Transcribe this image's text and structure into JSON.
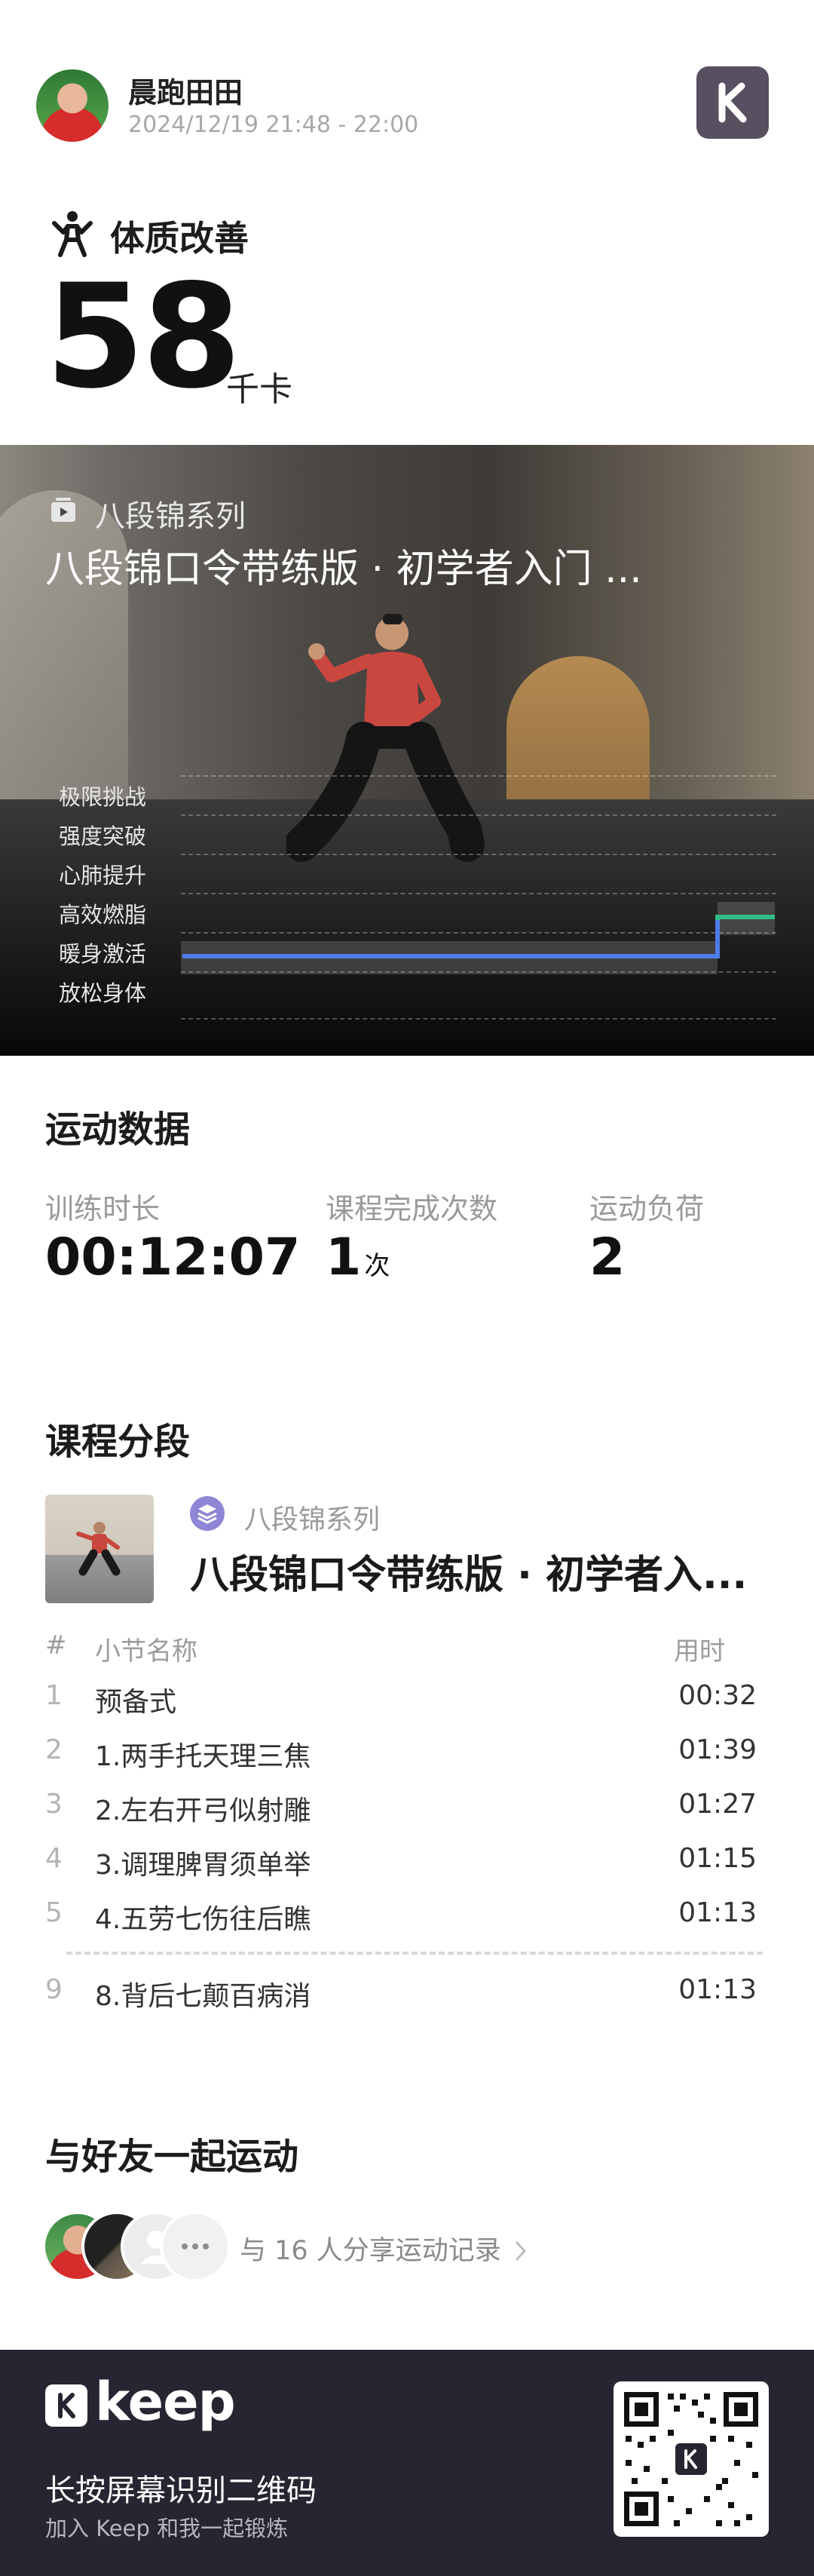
{
  "user": {
    "name": "晨跑田田",
    "time_range": "2024/12/19 21:48 - 22:00"
  },
  "goal": {
    "label": "体质改善",
    "calories": "58",
    "calories_unit": "千卡"
  },
  "hero": {
    "series": "八段锦系列",
    "course_title": "八段锦口令带练版 · 初学者入门 ...",
    "intensity_zones": [
      "极限挑战",
      "强度突破",
      "心肺提升",
      "高效燃脂",
      "暖身激活",
      "放松身体"
    ],
    "intensity_colors": {
      "warmup": "#4f7be6",
      "fatburn": "#2fbf84"
    }
  },
  "stats": {
    "title": "运动数据",
    "items": [
      {
        "label": "训练时长",
        "value": "00:12:07",
        "unit": ""
      },
      {
        "label": "课程完成次数",
        "value": "1",
        "unit": "次"
      },
      {
        "label": "运动负荷",
        "value": "2",
        "unit": ""
      }
    ]
  },
  "segments": {
    "title": "课程分段",
    "series": "八段锦系列",
    "course_title": "八段锦口令带练版 · 初学者入...",
    "headers": {
      "index": "#",
      "name": "小节名称",
      "time": "用时"
    },
    "rows": [
      {
        "index": "1",
        "name": "预备式",
        "time": "00:32"
      },
      {
        "index": "2",
        "name": "1.两手托天理三焦",
        "time": "01:39"
      },
      {
        "index": "3",
        "name": "2.左右开弓似射雕",
        "time": "01:27"
      },
      {
        "index": "4",
        "name": "3.调理脾胃须单举",
        "time": "01:15"
      },
      {
        "index": "5",
        "name": "4.五劳七伤往后瞧",
        "time": "01:13"
      }
    ],
    "last_row": {
      "index": "9",
      "name": "8.背后七颠百病消",
      "time": "01:13"
    }
  },
  "friends": {
    "title": "与好友一起运动",
    "share_text": "与 16 人分享运动记录",
    "more_icon": "ellipsis-icon"
  },
  "footer": {
    "brand": "keep",
    "title": "长按屏幕识别二维码",
    "subtitle": "加入 Keep 和我一起锻炼"
  }
}
